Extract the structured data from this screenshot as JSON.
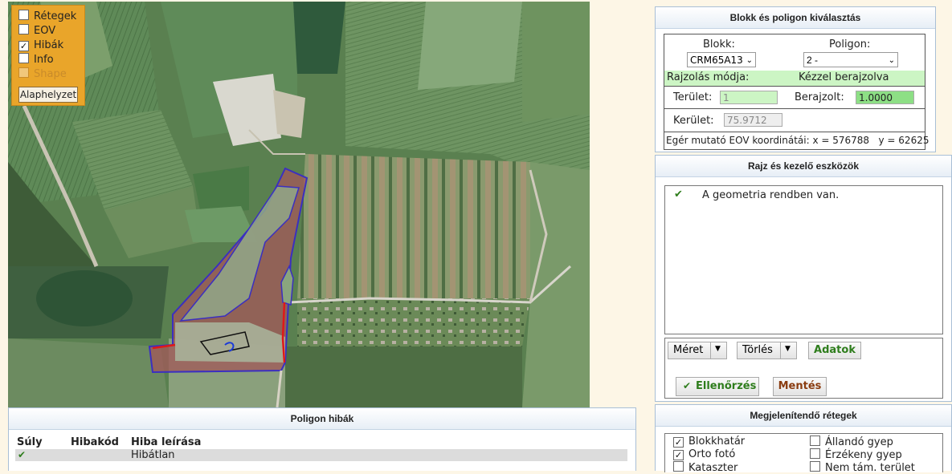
{
  "map_layers": {
    "items": [
      {
        "label": "Rétegek",
        "checked": false,
        "disabled": false
      },
      {
        "label": "EOV",
        "checked": false,
        "disabled": false
      },
      {
        "label": "Hibák",
        "checked": true,
        "disabled": false
      },
      {
        "label": "Info",
        "checked": false,
        "disabled": false
      },
      {
        "label": "Shape",
        "checked": false,
        "disabled": true
      }
    ],
    "reset_button": "Alaphelyzet"
  },
  "block_panel": {
    "title": "Blokk és poligon kiválasztás",
    "block_label": "Blokk:",
    "block_value": "CRM65A13",
    "polygon_label": "Poligon:",
    "polygon_value": "2 -",
    "draw_mode_label": "Rajzolás módja:",
    "draw_mode_value": "Kézzel berajzolva",
    "area_label": "Terület:",
    "area_value": "1",
    "drawn_label": "Berajzolt:",
    "drawn_value": "1.0000",
    "perimeter_label": "Kerület:",
    "perimeter_value": "75.9712",
    "coords_text": "Egér mutató EOV koordinátái: x = 576788   y = 62625"
  },
  "tools_panel": {
    "title": "Rajz és kezelő eszközök",
    "message": "A geometria rendben van.",
    "size_button": "Méret",
    "delete_button": "Törlés",
    "data_button": "Adatok",
    "check_button": "Ellenőrzés",
    "save_button": "Mentés"
  },
  "layers_panel": {
    "title": "Megjelenítendő rétegek",
    "left": [
      {
        "label": "Blokkhatár",
        "checked": true
      },
      {
        "label": "Orto fotó",
        "checked": true
      },
      {
        "label": "Kataszter",
        "checked": false
      }
    ],
    "right": [
      {
        "label": "Állandó gyep",
        "checked": false
      },
      {
        "label": "Érzékeny gyep",
        "checked": false
      },
      {
        "label": "Nem tám. terület",
        "checked": false
      }
    ]
  },
  "errors_panel": {
    "title": "Poligon hibák",
    "columns": [
      "Súly",
      "Hibakód",
      "Hiba leírása"
    ],
    "rows": [
      {
        "weight_icon": "check-icon",
        "code": "",
        "description": "Hibátlan"
      }
    ]
  },
  "colors": {
    "accent_orange": "#e9a52a",
    "polygon_fill": "#a05a5a",
    "polygon_border": "#3b2fc0",
    "error_line": "#e01818",
    "highlight_green": "#ccf5c4",
    "ok_green": "#2e7d1c"
  }
}
